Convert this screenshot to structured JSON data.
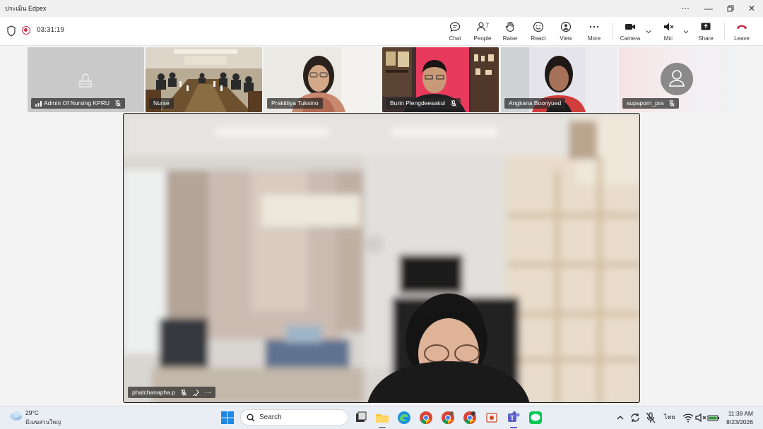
{
  "window": {
    "title": "ประเมิน Edpex",
    "controls": [
      "more-icon",
      "minimize-icon",
      "restore-icon",
      "close-icon"
    ]
  },
  "toolbar": {
    "timer": "03:31:19",
    "chat_label": "Chat",
    "people_label": "People",
    "people_count": "7",
    "raise_label": "Raise",
    "react_label": "React",
    "view_label": "View",
    "more_label": "More",
    "camera_label": "Camera",
    "mic_label": "Mic",
    "share_label": "Share",
    "leave_label": "Leave",
    "leave_color": "#c4314b",
    "record_color": "#c4314b"
  },
  "participants": [
    {
      "name": "Admin Of Nursing KPRU",
      "muted": true,
      "video": false
    },
    {
      "name": "Nurse",
      "muted": false,
      "video": true
    },
    {
      "name": "Prakittiya Tuksino",
      "muted": false,
      "video": true
    },
    {
      "name": "Burin Plengdeesakul",
      "muted": true,
      "video": true
    },
    {
      "name": "Angkana Boonyued",
      "muted": false,
      "video": true,
      "active": true
    },
    {
      "name": "supaporn_pra",
      "muted": true,
      "video": false
    }
  ],
  "main_video": {
    "name": "phatchanapha.p"
  },
  "taskbar": {
    "temperature": "29°C",
    "weather_desc": "มีเมฆส่วนใหญ่",
    "search_label": "Search",
    "language": "ไทย",
    "time": "11:38 AM",
    "date": "8/23/2026"
  },
  "accent_color": "#6264a7"
}
